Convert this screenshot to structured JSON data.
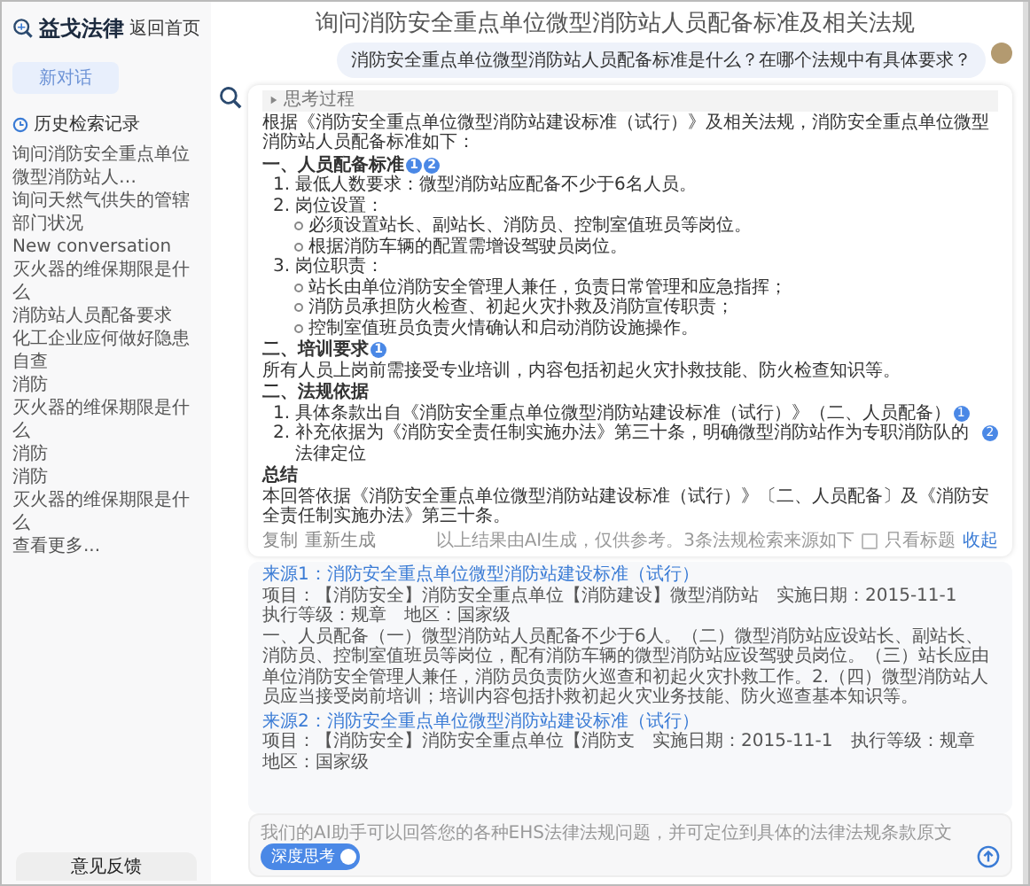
{
  "sidebar": {
    "logo": "益戈法律",
    "home_link": "返回首页",
    "new_chat_button": {
      "label": "新对话",
      "disabled": true
    },
    "history_title": "历史检索记录",
    "history": [
      "询问消防安全重点单位微型消防站人…",
      "询问天然气供失的管辖部门状况",
      "New conversation",
      "灭火器的维保期限是什么",
      "消防站人员配备要求",
      "化工企业应何做好隐患自查",
      "消防",
      "灭火器的维保期限是什么",
      "消防",
      "消防",
      "灭火器的维保期限是什么"
    ],
    "more_link": "查看更多...",
    "feedback_button": "意见反馈"
  },
  "chat": {
    "title": "询问消防安全重点单位微型消防站人员配备标准及相关法规",
    "user_message": "消防安全重点单位微型消防站人员配备标准是什么？在哪个法规中有具体要求？",
    "answer": {
      "thinking": {
        "label": "思考过程",
        "expanded": false
      },
      "blocks": [
        {
          "kind": "para",
          "text": "根据《消防安全重点单位微型消防站建设标准（试行）》及相关法规，消防安全重点单位微型消防站人员配备标准如下："
        },
        {
          "kind": "heading",
          "text": "一、人员配备标准",
          "cites": [
            "1",
            "2"
          ]
        },
        {
          "kind": "list",
          "items": [
            {
              "marker": "1.",
              "text": "最低人数要求：微型消防站应配备不少于6名人员。"
            },
            {
              "marker": "2.",
              "text": "岗位设置：",
              "children": [
                "必须设置站长、副站长、消防员、控制室值班员等岗位。",
                "根据消防车辆的配置需增设驾驶员岗位。"
              ]
            },
            {
              "marker": "3.",
              "text": "岗位职责：",
              "children": [
                "站长由单位消防安全管理人兼任，负责日常管理和应急指挥；",
                "消防员承担防火检查、初起火灾扑救及消防宣传职责；",
                "控制室值班员负责火情确认和启动消防设施操作。"
              ]
            }
          ]
        },
        {
          "kind": "heading",
          "text": "二、培训要求",
          "cites": [
            "1"
          ]
        },
        {
          "kind": "para",
          "text": "所有人员上岗前需接受专业培训，内容包括初起火灾扑救技能、防火检查知识等。"
        },
        {
          "kind": "heading",
          "text": "二、法规依据"
        },
        {
          "kind": "list",
          "items": [
            {
              "marker": "1.",
              "text": "具体条款出自《消防安全重点单位微型消防站建设标准（试行）》（二、人员配备）",
              "cites": [
                "1"
              ]
            },
            {
              "marker": "2.",
              "text": "补充依据为《消防安全责任制实施办法》第三十条，明确微型消防站作为专职消防队的法律定位",
              "cites": [
                "2"
              ]
            }
          ]
        },
        {
          "kind": "heading",
          "text": "总结"
        },
        {
          "kind": "para",
          "text": "本回答依据《消防安全重点单位微型消防站建设标准（试行）》〔二、人员配备〕及《消防安全责任制实施办法》第三十条。"
        }
      ],
      "footer": {
        "copy": "复制",
        "regenerate": "重新生成",
        "note": "以上结果由AI生成，仅供参考。3条法规检索来源如下",
        "title_only": {
          "label": "只看标题",
          "checked": false
        },
        "collapse": "收起"
      }
    },
    "sources": [
      {
        "title": "来源1：消防安全重点单位微型消防站建设标准（试行）",
        "meta": [
          "项目：【消防安全】消防安全重点单位【消防建设】微型消防站",
          "实施日期：2015-11-1",
          "执行等级：规章",
          "地区：国家级"
        ],
        "body": "一、人员配备（一）微型消防站人员配备不少于6人。（二）微型消防站应设站长、副站长、消防员、控制室值班员等岗位，配有消防车辆的微型消防站应设驾驶员岗位。（三）站长应由单位消防安全管理人兼任，消防员负责防火巡查和初起火灾扑救工作。2.（四）微型消防站人员应当接受岗前培训；培训内容包括扑救初起火灾业务技能、防火巡查基本知识等。"
      },
      {
        "title": "来源2：消防安全重点单位微型消防站建设标准（试行）",
        "meta": [
          "项目：【消防安全】消防安全重点单位【消防支",
          "实施日期：2015-11-1",
          "执行等级：规章",
          "地区：国家级"
        ]
      }
    ]
  },
  "input": {
    "placeholder": "我们的AI助手可以回答您的各种EHS法律法规问题，并可定位到具体的法律法规条款原文",
    "deep_think": {
      "label": "深度思考",
      "on": true
    }
  }
}
